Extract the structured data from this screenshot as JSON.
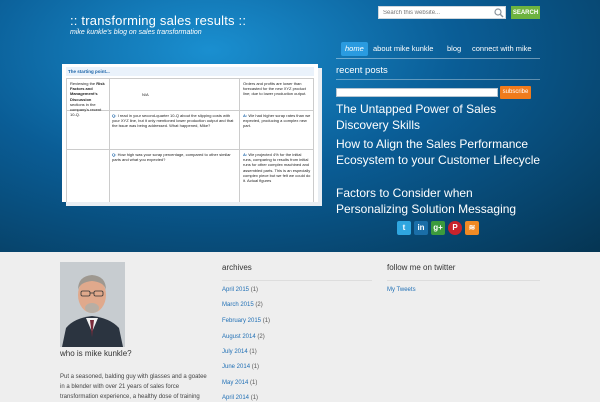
{
  "header": {
    "title": ":: transforming sales results ::",
    "tagline": "mike kunkle's blog on sales transformation",
    "search_placeholder": "Search this website...",
    "search_button": "SEARCH"
  },
  "nav": [
    "home",
    "about mike kunkle",
    "blog",
    "connect with mike"
  ],
  "slide": {
    "title": "The starting point...",
    "row1": {
      "col1_pre": "Reviewing the ",
      "col1_bold": "Risk Factors and Management's Discussion",
      "col1_post": " sections in the company's recent 10-Q.",
      "col2": "N/A",
      "col3": "Orders and profits are lower than forecasted for the new XYZ product line; due to lower production output."
    },
    "row2": {
      "q_label": "Q:",
      "q_text": "I read in your second-quarter 10-Q about the slipping costs with your XYZ line, but it only mentioned lower production output and that the issue was being addressed.  What happened, Mike?",
      "a_label": "A:",
      "a_text": "We had higher scrap rates than we expected, producing a complex new part."
    },
    "row3": {
      "q_label": "Q:",
      "q_text": "How high was your scrap percentage, compared to other similar parts and what you expected?",
      "a_label": "A:",
      "a_text": "We projected 4% for the initial runs, comparing to results from initial runs for other complex machined and assembled parts. This is an especially complex piece but we felt we could do it. Actual figures"
    }
  },
  "sidebar": {
    "recent_title": "recent posts",
    "subscribe": "subscribe",
    "posts": [
      "The Untapped Power of Sales Discovery Skills",
      "How to Align the Sales Performance Ecosystem to your Customer Lifecycle",
      "Factors to Consider when Personalizing Solution Messaging"
    ],
    "social": [
      "twitter-icon",
      "linkedin-icon",
      "google-plus-icon",
      "pinterest-icon",
      "rss-icon"
    ]
  },
  "about": {
    "heading": "who is mike kunkle?",
    "bio": "Put a seasoned, balding guy with glasses and a goatee in a blender with over 21 years of sales force transformation experience, a healthy dose of training"
  },
  "archives": {
    "heading": "archives",
    "items": [
      {
        "month": "April 2015",
        "count": "(1)"
      },
      {
        "month": "March 2015",
        "count": "(2)"
      },
      {
        "month": "February 2015",
        "count": "(1)"
      },
      {
        "month": "August 2014",
        "count": "(2)"
      },
      {
        "month": "July 2014",
        "count": "(1)"
      },
      {
        "month": "June 2014",
        "count": "(1)"
      },
      {
        "month": "May 2014",
        "count": "(1)"
      },
      {
        "month": "April 2014",
        "count": "(1)"
      }
    ]
  },
  "twitter": {
    "heading": "follow me on twitter",
    "link": "My Tweets"
  },
  "colors": {
    "accent": "#2a9be0",
    "search_button": "#6db33f",
    "subscribe": "#f07b1b"
  }
}
